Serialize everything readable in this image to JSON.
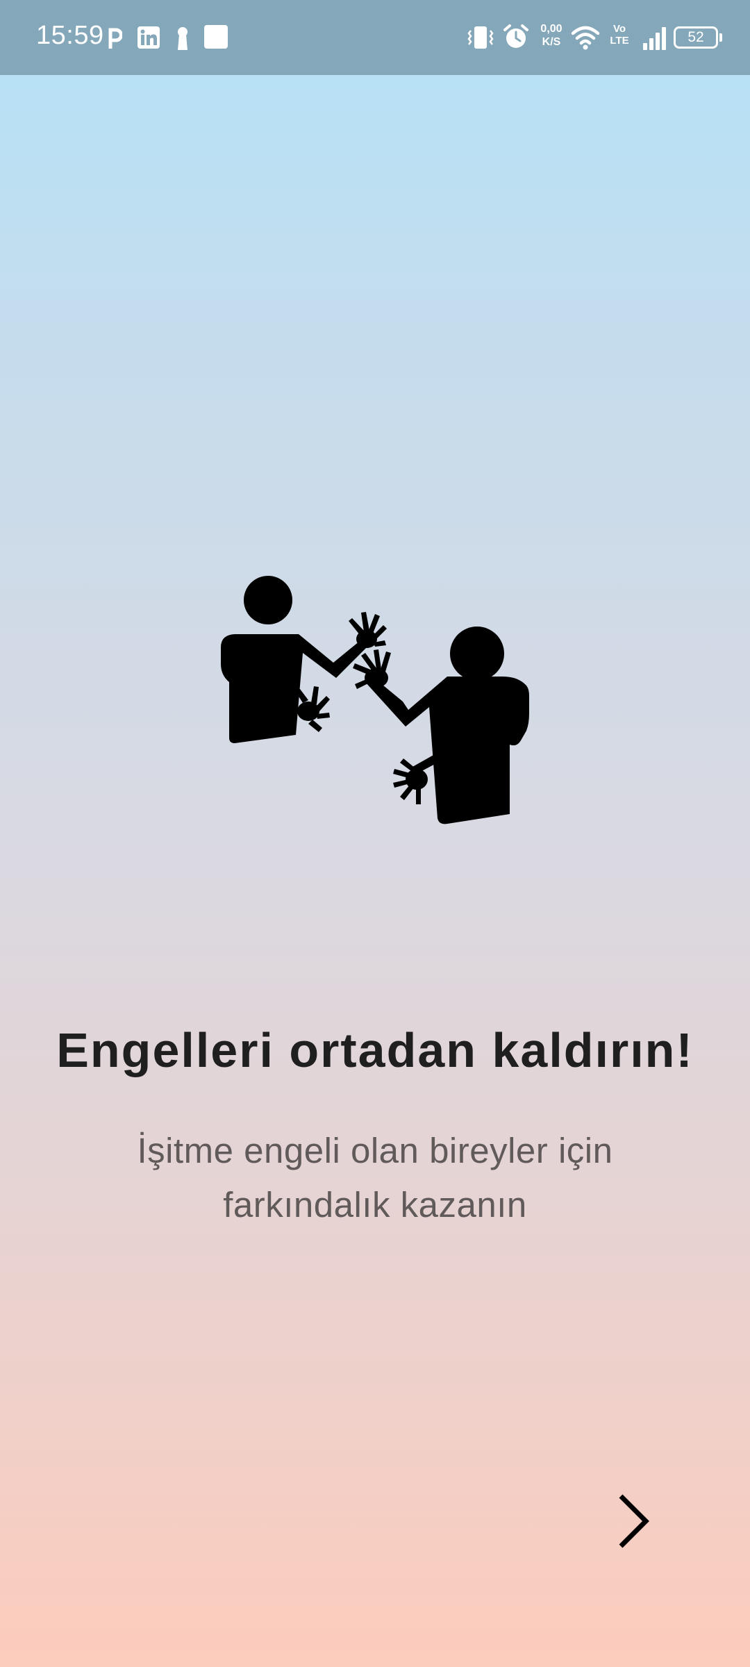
{
  "status_bar": {
    "time": "15:59",
    "network_speed_value": "0,00",
    "network_speed_unit": "K/S",
    "volte_top": "Vo",
    "volte_bottom": "LTE",
    "battery_level": "52",
    "notification_icons": [
      "parking-app-icon",
      "linkedin-icon",
      "keyhole-icon",
      "blank-notification-icon"
    ],
    "system_icons": [
      "vibrate-icon",
      "alarm-icon",
      "wifi-icon",
      "signal-icon",
      "battery-icon"
    ]
  },
  "onboarding": {
    "illustration": "sign-language-people-icon",
    "title": "Engelleri ortadan kaldırın!",
    "subtitle_line1": "İşitme engeli olan bireyler için",
    "subtitle_line2": "farkındalık kazanın",
    "next_icon": "chevron-right-icon"
  },
  "colors": {
    "status_bar": "#84a7b9",
    "gradient_top": "#b4e2f8",
    "gradient_bottom": "#fcccbc",
    "title_text": "#1f1f1f",
    "subtitle_text": "#615a5a"
  }
}
